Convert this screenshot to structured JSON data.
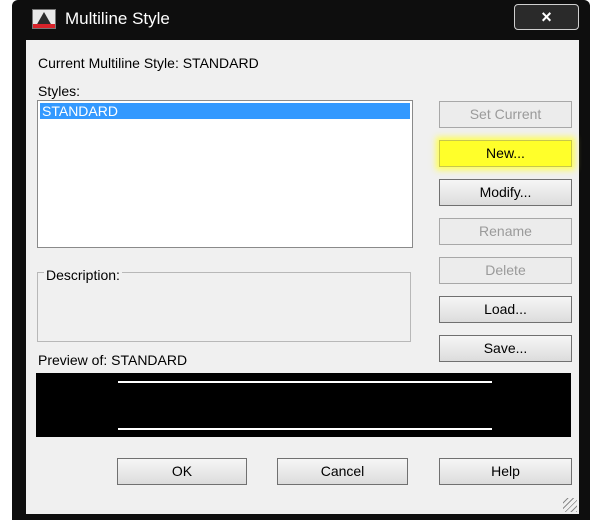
{
  "window": {
    "title": "Multiline Style",
    "close_glyph": "×",
    "app_icon": "autocad-icon"
  },
  "current_style": "Current Multiline Style: STANDARD",
  "styles": {
    "label": "Styles:",
    "items": [
      "STANDARD"
    ],
    "selected": "STANDARD"
  },
  "description": {
    "label": "Description:"
  },
  "preview": {
    "label": "Preview of: STANDARD"
  },
  "buttons": {
    "set_current": "Set Current",
    "new": "New...",
    "modify": "Modify...",
    "rename": "Rename",
    "delete": "Delete",
    "load": "Load...",
    "save": "Save...",
    "ok": "OK",
    "cancel": "Cancel",
    "help": "Help"
  },
  "colors": {
    "selection": "#3399ff",
    "highlight": "#ffff2a",
    "title_bar": "#0e0e0e",
    "preview_background": "#000000"
  }
}
